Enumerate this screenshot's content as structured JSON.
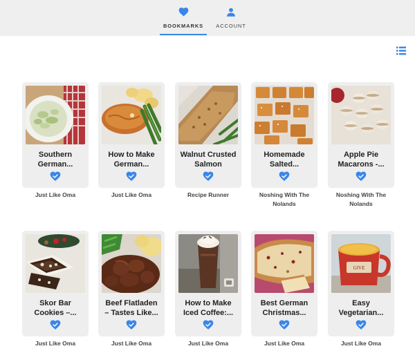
{
  "nav": {
    "tabs": [
      {
        "label": "BOOKMARKS",
        "icon": "heart-icon",
        "active": true
      },
      {
        "label": "ACCOUNT",
        "icon": "person-icon",
        "active": false
      }
    ],
    "list_view_icon": "list-view-icon"
  },
  "colors": {
    "accent": "#3a86e8",
    "topbar_bg": "#efefef",
    "card_bg": "#eeeeee"
  },
  "recipes": [
    {
      "title_line1": "Southern",
      "title_line2": "German...",
      "source_line1": "Just Like Oma",
      "source_line2": "",
      "image": "cucumber-salad"
    },
    {
      "title_line1": "How to Make",
      "title_line2": "German...",
      "source_line1": "Just Like Oma",
      "source_line2": "",
      "image": "schnitzel-with-asparagus"
    },
    {
      "title_line1": "Walnut Crusted",
      "title_line2": "Salmon",
      "source_line1": "Recipe Runner",
      "source_line2": "",
      "image": "walnut-crusted-salmon"
    },
    {
      "title_line1": "Homemade",
      "title_line2": "Salted...",
      "source_line1": "Noshing With The",
      "source_line2": "Nolands",
      "image": "salted-caramels"
    },
    {
      "title_line1": "Apple Pie",
      "title_line2": "Macarons -...",
      "source_line1": "Noshing With The",
      "source_line2": "Nolands",
      "image": "macarons"
    },
    {
      "title_line1": "Skor Bar",
      "title_line2": "Cookies –...",
      "source_line1": "Just Like Oma",
      "source_line2": "",
      "image": "skor-bar-cookies"
    },
    {
      "title_line1": "Beef Flatladen",
      "title_line2": "– Tastes Like...",
      "source_line1": "Just Like Oma",
      "source_line2": "",
      "image": "beef-rouladen"
    },
    {
      "title_line1": "How to Make",
      "title_line2": "Iced Coffee:...",
      "source_line1": "Just Like Oma",
      "source_line2": "",
      "image": "iced-coffee"
    },
    {
      "title_line1": "Best German",
      "title_line2": "Christmas...",
      "source_line1": "Just Like Oma",
      "source_line2": "",
      "image": "christmas-stollen"
    },
    {
      "title_line1": "Easy",
      "title_line2": "Vegetarian...",
      "source_line1": "Just Like Oma",
      "source_line2": "",
      "image": "soup-mug"
    }
  ]
}
